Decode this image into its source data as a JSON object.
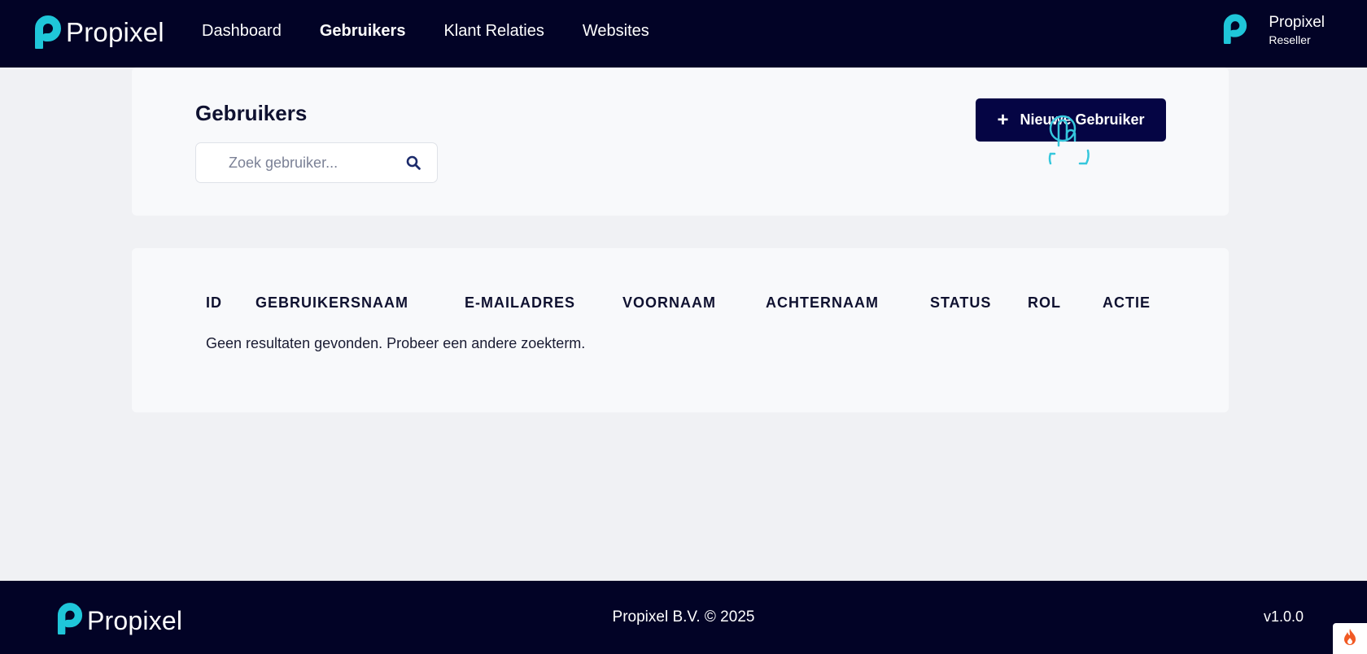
{
  "colors": {
    "nav_bg": "#020326",
    "accent_cyan": "#1fc6d9",
    "button_bg": "#050544",
    "page_bg": "#f0f1f4",
    "card_bg": "#f8f9fb"
  },
  "brand": {
    "name": "Propixel",
    "logo_icon": "propixel-p-logo"
  },
  "nav": {
    "items": [
      {
        "label": "Dashboard",
        "active": false
      },
      {
        "label": "Gebruikers",
        "active": true
      },
      {
        "label": "Klant Relaties",
        "active": false
      },
      {
        "label": "Websites",
        "active": false
      }
    ]
  },
  "user": {
    "name": "Propixel",
    "role": "Reseller",
    "avatar_icon": "propixel-p-logo"
  },
  "header": {
    "title": "Gebruikers",
    "search_placeholder": "Zoek gebruiker...",
    "search_icon": "search-icon",
    "new_button_label": "Nieuwe Gebruiker",
    "new_button_icon": "plus-icon"
  },
  "table": {
    "columns": [
      "ID",
      "GEBRUIKERSNAAM",
      "E-MAILADRES",
      "VOORNAAM",
      "ACHTERNAAM",
      "STATUS",
      "ROL",
      "ACTIE"
    ],
    "rows": [],
    "empty_message": "Geen resultaten gevonden. Probeer een andere zoekterm."
  },
  "footer": {
    "brand": "Propixel",
    "copyright": "Propixel B.V. © 2025",
    "version": "v1.0.0"
  }
}
